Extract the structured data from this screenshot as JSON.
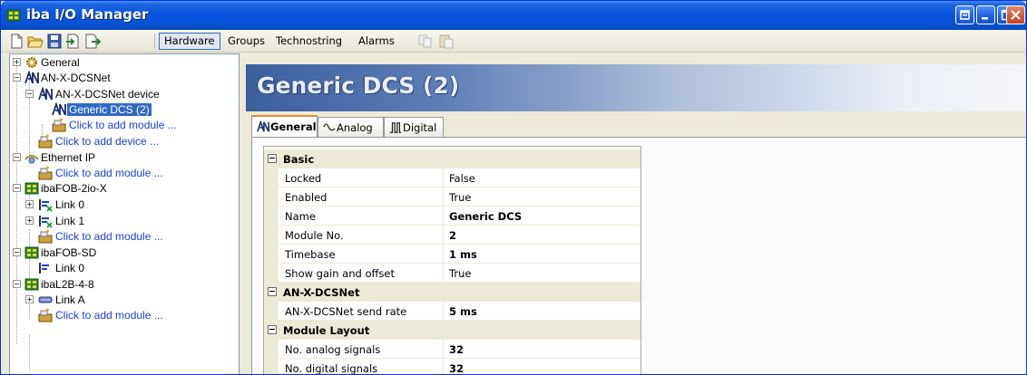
{
  "window": {
    "title": "iba I/O Manager"
  },
  "toolbar": {
    "icons": [
      "new-icon",
      "open-icon",
      "save-icon",
      "import-icon",
      "export-icon",
      "copy-icon",
      "paste-icon"
    ],
    "tabs": [
      "Hardware",
      "Groups",
      "Technostring",
      "Alarms"
    ]
  },
  "tree": {
    "nodes": [
      {
        "label": "General",
        "icon": "gear-icon"
      },
      {
        "label": "AN-X-DCSNet",
        "icon": "anx-icon"
      },
      {
        "label": "AN-X-DCSNet device",
        "icon": "anx-icon"
      },
      {
        "label": "Generic DCS (2)",
        "icon": "anx-icon"
      },
      {
        "label": "Click to add module ...",
        "icon": "add-module-icon"
      },
      {
        "label": "Click to add device ...",
        "icon": "add-device-icon"
      },
      {
        "label": "Ethernet IP",
        "icon": "network-icon"
      },
      {
        "label": "Click to add module ...",
        "icon": "add-module-icon"
      },
      {
        "label": "ibaFOB-2io-X",
        "icon": "board-icon"
      },
      {
        "label": "Link 0",
        "icon": "link-icon"
      },
      {
        "label": "Link 1",
        "icon": "link-icon"
      },
      {
        "label": "Click to add module ...",
        "icon": "add-module-icon"
      },
      {
        "label": "ibaFOB-SD",
        "icon": "board-icon"
      },
      {
        "label": "Link 0",
        "icon": "link-icon"
      },
      {
        "label": "ibaL2B-4-8",
        "icon": "board-icon"
      },
      {
        "label": "Link A",
        "icon": "cable-icon"
      },
      {
        "label": "Click to add module ...",
        "icon": "add-module-icon"
      }
    ]
  },
  "main": {
    "title": "Generic DCS (2)",
    "tabs": [
      {
        "label": "General",
        "icon": "anx-icon"
      },
      {
        "label": "Analog",
        "icon": "analog-wave-icon"
      },
      {
        "label": "Digital",
        "icon": "digital-wave-icon"
      }
    ],
    "properties": {
      "cat_basic": "Basic",
      "locked_name": "Locked",
      "locked_value": "False",
      "enabled_name": "Enabled",
      "enabled_value": "True",
      "name_name": "Name",
      "name_value": "Generic DCS",
      "module_no_name": "Module No.",
      "module_no_value": "2",
      "timebase_name": "Timebase",
      "timebase_value": "1 ms",
      "show_gain_name": "Show gain and offset",
      "show_gain_value": "True",
      "cat_anx": "AN-X-DCSNet",
      "send_rate_name": "AN-X-DCSNet send rate",
      "send_rate_value": "5 ms",
      "cat_layout": "Module Layout",
      "analog_signals_name": "No. analog signals",
      "analog_signals_value": "32",
      "digital_signals_name": "No. digital signals",
      "digital_signals_value": "32"
    }
  },
  "colors": {
    "titlebar": "#0a55df",
    "selection": "#316ac5",
    "link_text": "#1a3fd6",
    "active_tab_accent": "#e68b2c"
  }
}
